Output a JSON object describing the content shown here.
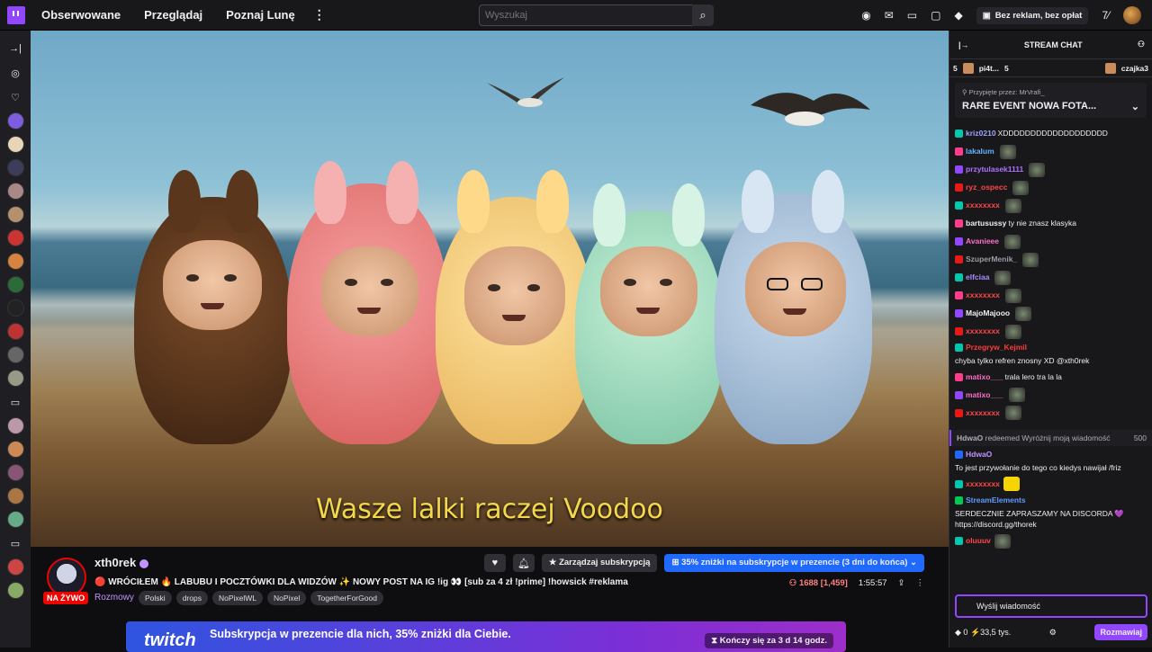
{
  "nav": {
    "following": "Obserwowane",
    "browse": "Przeglądaj",
    "meet": "Poznaj Lunę",
    "more": "⋮",
    "search_placeholder": "Wyszukaj",
    "no_ads": "Bez reklam, bez opłat"
  },
  "video": {
    "subtitle": "Wasze lalki raczej Voodoo"
  },
  "channel": {
    "name": "xth0rek",
    "live_label": "NA ŻYWO",
    "title": "🔴 WRÓCIŁEM 🔥 LABUBU I POCZTÓWKI DLA WIDZÓW ✨ NOWY POST NA IG !ig 👀 [sub za 4 zł !prime] !howsick #reklama",
    "category": "Rozmowy",
    "tags": [
      "Polski",
      "drops",
      "NoPixelWL",
      "NoPixel",
      "TogetherForGood"
    ],
    "manage_sub": "Zarządzaj subskrypcją",
    "gift_offer": "35% zniżki na subskrypcje w prezencie (3 dni do końca)",
    "viewers": "1688 [1,459]",
    "uptime": "1:55:57"
  },
  "banner": {
    "logo": "twitch",
    "text": "Subskrypcja w prezencie dla nich, 35% zniżki dla Ciebie.",
    "timer": "Kończy się za 3 d 14 godz."
  },
  "chat": {
    "header": "STREAM CHAT",
    "gifts": [
      {
        "count": "5",
        "user": "pi4t...",
        "count2": "5"
      },
      {
        "user": "czajka3"
      }
    ],
    "pinned_by": "Przypięte przez:",
    "pinned_by_user": "MrVrafi_",
    "pinned_msg": "RARE EVENT NOWA FOTA...",
    "messages": [
      {
        "user": "kriz0210",
        "color": "#9ca4ff",
        "text": "XDDDDDDDDDDDDDDDDDDD"
      },
      {
        "user": "lakalum",
        "color": "#5fb4ff",
        "text": ""
      },
      {
        "user": "przytulasek1111",
        "color": "#b070ff",
        "text": ""
      },
      {
        "user": "ryz_ospecc",
        "color": "#ff4747",
        "text": ""
      },
      {
        "user": "xxxxxxxx",
        "color": "#ff4747",
        "text": ""
      },
      {
        "user": "bartusussy",
        "color": "#efeff1",
        "text": "ty nie znasz klasyka"
      },
      {
        "user": "Avanieee",
        "color": "#ff6ec7",
        "text": ""
      },
      {
        "user": "SzuperMenik_",
        "color": "#9a9aa3",
        "text": ""
      },
      {
        "user": "elfciaa",
        "color": "#a78bff",
        "text": ""
      },
      {
        "user": "xxxxxxxx",
        "color": "#ff4747",
        "text": ""
      },
      {
        "user": "MajoMajooo",
        "color": "#efeff1",
        "text": ""
      },
      {
        "user": "xxxxxxxx",
        "color": "#ff4747",
        "text": ""
      },
      {
        "user": "Przegryw_Kejmil",
        "color": "#ff3a3a",
        "text": "chyba tylko refren znosny XD @xth0rek"
      },
      {
        "user": "matixo___",
        "color": "#ff6ec7",
        "text": "trala lero tra la la"
      },
      {
        "user": "matixo___",
        "color": "#ff6ec7",
        "text": ""
      },
      {
        "user": "xxxxxxxx",
        "color": "#ff4747",
        "text": ""
      }
    ],
    "redeem_user": "HdwaO",
    "redeem_text": "redeemed Wyróżnij moją wiadomość",
    "redeem_cost": "500",
    "msg2_user": "HdwaO",
    "msg2_text": "To jest przywołanie do tego co kiedys nawijał /friz",
    "msg3_user": "xxxxxxxx",
    "msg4_user": "StreamElements",
    "msg4_text": "SERDECZNIE ZAPRASZAMY NA DISCORDA 💜 https://discord.gg/thorek",
    "msg5_user": "oluuuv",
    "input_placeholder": "Wyślij wiadomość",
    "points": "0",
    "bits": "33,5 tys.",
    "send": "Rozmawiaj"
  }
}
